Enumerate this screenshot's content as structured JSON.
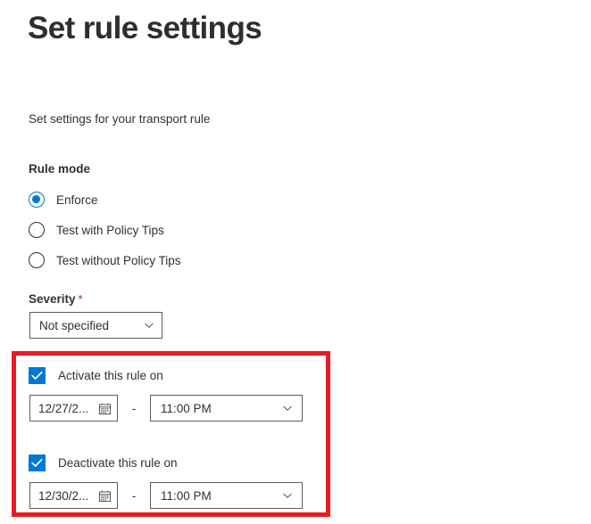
{
  "header": {
    "title": "Set rule settings",
    "subtitle": "Set settings for your transport rule"
  },
  "rule_mode": {
    "label": "Rule mode",
    "options": [
      {
        "label": "Enforce",
        "selected": true
      },
      {
        "label": "Test with Policy Tips",
        "selected": false
      },
      {
        "label": "Test without Policy Tips",
        "selected": false
      }
    ]
  },
  "severity": {
    "label": "Severity",
    "required_marker": "*",
    "value": "Not specified",
    "chevron_icon": "chevron-down-icon"
  },
  "schedule": {
    "activate": {
      "checkbox_label": "Activate this rule on",
      "checked": true,
      "date_value": "12/27/2...",
      "calendar_icon": "calendar-icon",
      "separator": "-",
      "time_value": "11:00 PM",
      "chevron_icon": "chevron-down-icon"
    },
    "deactivate": {
      "checkbox_label": "Deactivate this rule on",
      "checked": true,
      "date_value": "12/30/2...",
      "calendar_icon": "calendar-icon",
      "separator": "-",
      "time_value": "11:00 PM",
      "chevron_icon": "chevron-down-icon"
    }
  },
  "colors": {
    "accent": "#0078d4",
    "highlight_border": "#e81c24",
    "required_star": "#a4262c",
    "text": "#323130",
    "field_border": "#605e5c"
  }
}
